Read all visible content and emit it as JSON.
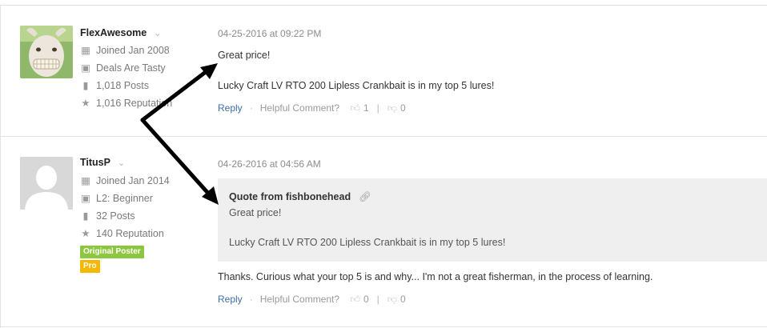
{
  "posts": [
    {
      "username": "FlexAwesome",
      "joined": "Joined Jan 2008",
      "rank": "Deals Are Tasty",
      "posts": "1,018 Posts",
      "reputation": "1,016 Reputation",
      "timestamp": "04-25-2016 at 09:22 PM",
      "body_line1": "Great price!",
      "body_line2": "Lucky Craft LV RTO 200 Lipless Crankbait is in my top 5 lures!",
      "reply": "Reply",
      "helpful": "Helpful Comment?",
      "upvotes": "1",
      "downvotes": "0"
    },
    {
      "username": "TitusP",
      "joined": "Joined Jan 2014",
      "rank": "L2: Beginner",
      "posts": "32 Posts",
      "reputation": "140 Reputation",
      "badge_op": "Original Poster",
      "badge_pro": "Pro",
      "timestamp": "04-26-2016 at 04:56 AM",
      "quote_from": "Quote from fishbonehead",
      "quote_line1": "Great price!",
      "quote_line2": "Lucky Craft LV RTO 200 Lipless Crankbait is in my top 5 lures!",
      "body": "Thanks. Curious what your top 5 is and why... I'm not a great fisherman, in the process of learning.",
      "reply": "Reply",
      "helpful": "Helpful Comment?",
      "upvotes": "0",
      "downvotes": "0"
    }
  ],
  "icons": {
    "user_menu": "chevron-down-icon",
    "joined": "calendar-icon",
    "rank": "id-card-icon",
    "posts": "speech-bubble-icon",
    "reputation": "star-icon",
    "quote_link": "link-icon",
    "upvote": "thumbs-up-icon",
    "downvote": "thumbs-down-icon"
  },
  "colors": {
    "link": "#3d6ea8",
    "badge_op": "#8dc63f",
    "badge_pro": "#f3b800",
    "quote_bg": "#efefef",
    "annotation_arrow": "#000000"
  }
}
